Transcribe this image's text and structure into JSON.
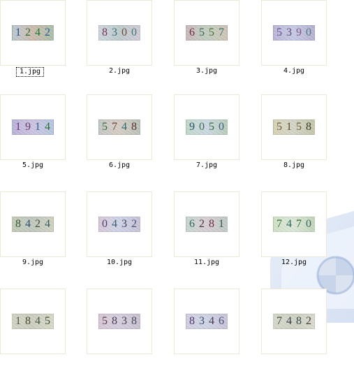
{
  "files": [
    {
      "name": "1.jpg",
      "captcha": "1242",
      "digit_colors": [
        "#1f4b8f",
        "#2e6b2f",
        "#1e7a35",
        "#2b5a95"
      ],
      "bg_colors": [
        "#b9c6d0",
        "#c7b3a3",
        "#a7bda5"
      ]
    },
    {
      "name": "2.jpg",
      "captcha": "8300",
      "digit_colors": [
        "#7d2f52",
        "#3d6a74",
        "#6a4a3a",
        "#3b7b72"
      ],
      "bg_colors": [
        "#c9d5df",
        "#b5c6c7",
        "#d3c9d6"
      ]
    },
    {
      "name": "3.jpg",
      "captcha": "6557",
      "digit_colors": [
        "#6d2a3f",
        "#2f6a4f",
        "#4a6a2a",
        "#356f6b"
      ],
      "bg_colors": [
        "#c7b6bc",
        "#bac9b8",
        "#cfc3b4"
      ]
    },
    {
      "name": "4.jpg",
      "captcha": "5390",
      "digit_colors": [
        "#5c4f8a",
        "#5d4c7a",
        "#7f5b8c",
        "#4f7c8b"
      ],
      "bg_colors": [
        "#b9b3d8",
        "#c0c4e3",
        "#b4aed0"
      ]
    },
    {
      "name": "5.jpg",
      "captcha": "1914",
      "digit_colors": [
        "#6b2f7f",
        "#6a3a6f",
        "#2e5f88",
        "#2a6b3a"
      ],
      "bg_colors": [
        "#b7aed8",
        "#c7bde1",
        "#b3c7e2"
      ]
    },
    {
      "name": "6.jpg",
      "captcha": "5748",
      "digit_colors": [
        "#2f6a39",
        "#6b3f2f",
        "#2e6a6a",
        "#5b2f2f"
      ],
      "bg_colors": [
        "#c3c6c3",
        "#d2c8bf",
        "#b5c1b6"
      ]
    },
    {
      "name": "7.jpg",
      "captcha": "9050",
      "digit_colors": [
        "#2b4f6f",
        "#3b6a52",
        "#2f6a3a",
        "#3b5f7a"
      ],
      "bg_colors": [
        "#bfd9c8",
        "#c6d5e2",
        "#b8ccb8"
      ]
    },
    {
      "name": "8.jpg",
      "captcha": "5158",
      "digit_colors": [
        "#6b5a3a",
        "#5a4a2a",
        "#6a5a2f",
        "#3a3a2a"
      ],
      "bg_colors": [
        "#d7d2b3",
        "#cfd1c0",
        "#c2c5a7"
      ]
    },
    {
      "name": "9.jpg",
      "captcha": "8424",
      "digit_colors": [
        "#2f5a2f",
        "#2e4f6a",
        "#3f4f2f",
        "#3a5f5a"
      ],
      "bg_colors": [
        "#c2c9b3",
        "#b9c2b8",
        "#d0d3c0"
      ]
    },
    {
      "name": "10.jpg",
      "captcha": "0432",
      "digit_colors": [
        "#4a3f6a",
        "#3a5f7a",
        "#3f3f5a",
        "#4a4f7a"
      ],
      "bg_colors": [
        "#d9c7d9",
        "#c9d0e6",
        "#c7c1d8"
      ]
    },
    {
      "name": "11.jpg",
      "captcha": "6281",
      "digit_colors": [
        "#2f6a5a",
        "#5a2f3a",
        "#6a2f3a",
        "#2f5a4a"
      ],
      "bg_colors": [
        "#c7d6d0",
        "#d2cad1",
        "#bfc9c5"
      ]
    },
    {
      "name": "12.jpg",
      "captcha": "7470",
      "digit_colors": [
        "#3a6a3a",
        "#2f6a5a",
        "#2f6a2f",
        "#3a6a6a"
      ],
      "bg_colors": [
        "#cfe3c4",
        "#d9e6d6",
        "#bfd6b6"
      ]
    },
    {
      "name": "",
      "captcha": "1845",
      "digit_colors": [
        "#4a5a3a",
        "#4a4a2a",
        "#4a5a4a",
        "#3a4a3a"
      ],
      "bg_colors": [
        "#d0d2c3",
        "#c7c9b8",
        "#d8dbc6"
      ]
    },
    {
      "name": "",
      "captcha": "5838",
      "digit_colors": [
        "#5a3a4a",
        "#4a3a5a",
        "#4a3a4a",
        "#4a4a5a"
      ],
      "bg_colors": [
        "#d7c6d4",
        "#d0c9dc",
        "#c8c0d2"
      ]
    },
    {
      "name": "",
      "captcha": "8346",
      "digit_colors": [
        "#4a3a6a",
        "#3a4a6a",
        "#4a3a5a",
        "#4a4a6a"
      ],
      "bg_colors": [
        "#d2cde3",
        "#c9d1e3",
        "#c8c2dc"
      ]
    },
    {
      "name": "",
      "captcha": "7482",
      "digit_colors": [
        "#3a4a3a",
        "#3a3a4a",
        "#3a4a4a",
        "#4a3a3a"
      ],
      "bg_colors": [
        "#d3d7c8",
        "#c9cdbd",
        "#d9dccd"
      ]
    }
  ],
  "ui": {
    "focus_outline_color": "#000000",
    "thumbnail_border_color": "#ece9d8"
  }
}
